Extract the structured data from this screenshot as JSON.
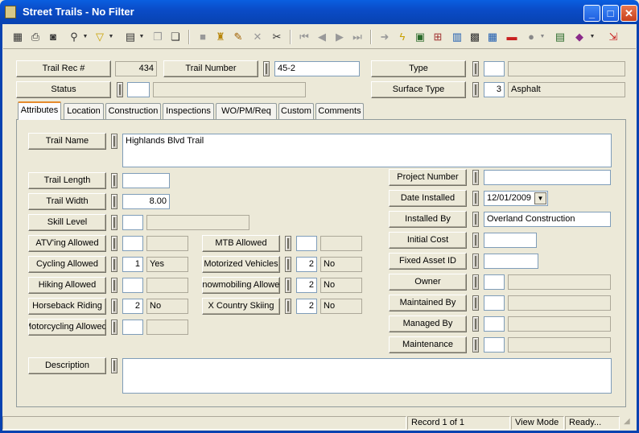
{
  "window": {
    "title": "Street Trails - No Filter",
    "minimize": "_",
    "maximize": "□",
    "close": "✕"
  },
  "header": {
    "trail_rec_label": "Trail Rec #",
    "trail_rec_value": "434",
    "trail_number_label": "Trail Number",
    "trail_number_value": "45-2",
    "type_label": "Type",
    "status_label": "Status",
    "surface_type_label": "Surface Type",
    "surface_type_code": "3",
    "surface_type_value": "Asphalt"
  },
  "tabs": [
    "Attributes",
    "Location",
    "Construction",
    "Inspections",
    "WO/PM/Req",
    "Custom",
    "Comments"
  ],
  "attributes": {
    "trail_name_label": "Trail Name",
    "trail_name_value": "Highlands Blvd Trail",
    "trail_length_label": "Trail Length",
    "trail_width_label": "Trail Width",
    "trail_width_value": "8.00",
    "skill_level_label": "Skill Level",
    "atving_label": "ATV'ing Allowed",
    "cycling_label": "Cycling Allowed",
    "cycling_code": "1",
    "cycling_value": "Yes",
    "hiking_label": "Hiking Allowed",
    "horseback_label": "Horseback Riding",
    "horseback_code": "2",
    "horseback_value": "No",
    "motorcycling_label": "Motorcycling Allowed",
    "mtb_label": "MTB Allowed",
    "motorized_label": "Motorized Vehicles",
    "motorized_code": "2",
    "motorized_value": "No",
    "snowmobiling_label": "Snowmobiling Allowed",
    "snowmobiling_code": "2",
    "snowmobiling_value": "No",
    "xcountry_label": "X Country Skiing",
    "xcountry_code": "2",
    "xcountry_value": "No",
    "project_number_label": "Project Number",
    "date_installed_label": "Date Installed",
    "date_installed_value": "12/01/2009",
    "installed_by_label": "Installed By",
    "installed_by_value": "Overland Construction",
    "initial_cost_label": "Initial Cost",
    "fixed_asset_label": "Fixed Asset ID",
    "owner_label": "Owner",
    "maintained_by_label": "Maintained By",
    "managed_by_label": "Managed By",
    "maintenance_label": "Maintenance",
    "description_label": "Description"
  },
  "statusbar": {
    "record": "Record 1 of 1",
    "mode": "View Mode",
    "state": "Ready..."
  },
  "toolbar_icons": [
    "new-icon",
    "print-icon",
    "preview-icon",
    "search-icon",
    "filter-icon",
    "report-icon",
    "copy-icon",
    "paste-icon",
    "save-icon",
    "stamp-icon",
    "edit-icon",
    "delete-icon",
    "cut-icon",
    "first-icon",
    "prev-icon",
    "next-icon",
    "last-icon",
    "goto-icon",
    "lightning-icon",
    "map-icon",
    "link-icon",
    "chart-icon",
    "calc-icon",
    "grid-icon",
    "car-icon",
    "globe-icon",
    "calculator-icon",
    "book-icon",
    "exit-icon"
  ],
  "colors": {
    "titlebar": "#0a4cc8",
    "tab_accent": "#e68b2c"
  }
}
